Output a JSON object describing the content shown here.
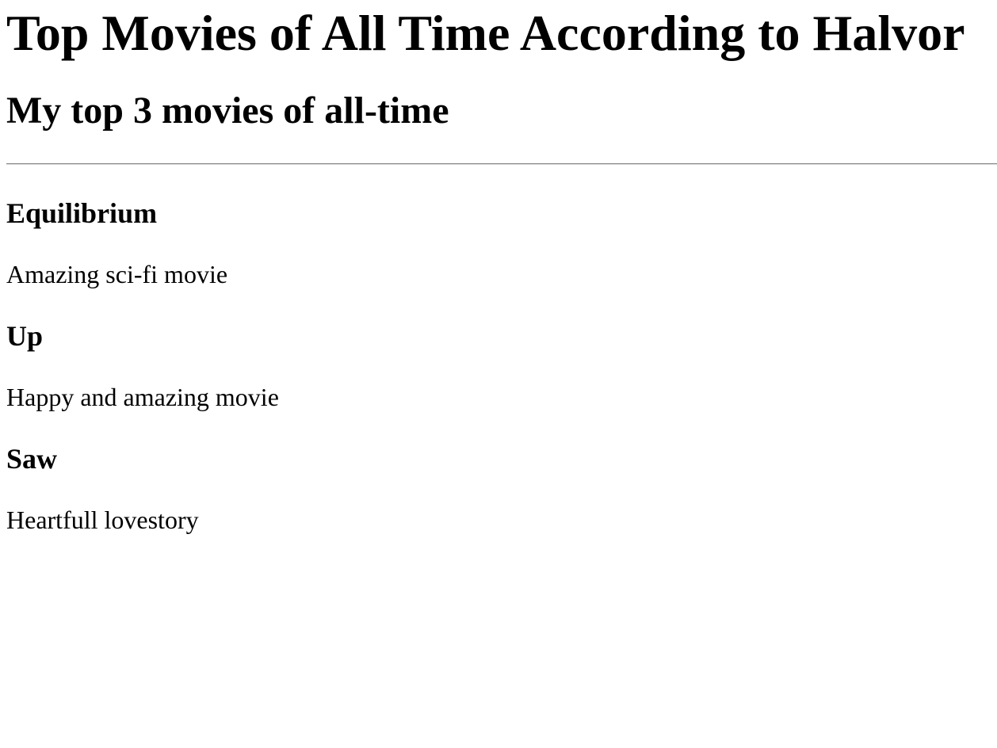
{
  "page": {
    "title": "Top Movies of All Time According to Halvor",
    "subtitle": "My top 3 movies of all-time"
  },
  "movies": [
    {
      "title": "Equilibrium",
      "description": "Amazing sci-fi movie"
    },
    {
      "title": "Up",
      "description": "Happy and amazing movie"
    },
    {
      "title": "Saw",
      "description": "Heartfull lovestory"
    }
  ]
}
